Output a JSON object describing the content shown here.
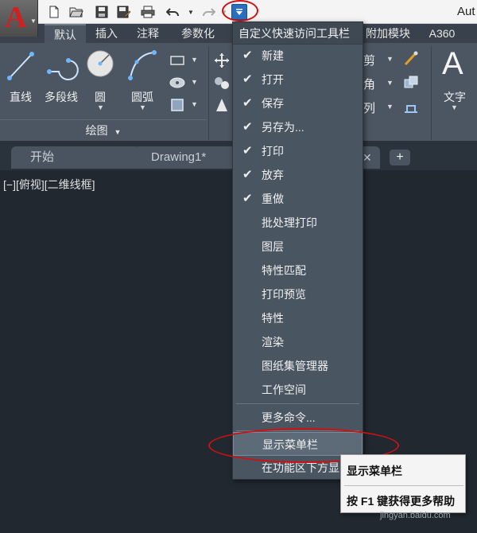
{
  "window": {
    "title_fragment": "Aut"
  },
  "quick_access": {
    "icons": [
      "new-icon",
      "open-icon",
      "save-icon",
      "save-as-icon",
      "print-icon",
      "undo-icon",
      "redo-icon",
      "customize-dropdown-icon"
    ]
  },
  "ribbon_tabs": [
    "默认",
    "插入",
    "注释",
    "参数化",
    "附加模块",
    "A360"
  ],
  "ribbon": {
    "tools": [
      "直线",
      "多段线",
      "圆",
      "圆弧"
    ],
    "panel_title": "绘图",
    "right_labels": [
      "剪",
      "角",
      "列"
    ],
    "text_tool": "文字"
  },
  "doc_tabs": [
    "开始",
    "Drawing1*"
  ],
  "viewport_label": "[−][俯视][二维线框]",
  "menu": {
    "title": "自定义快速访问工具栏",
    "items": [
      {
        "label": "新建",
        "checked": true
      },
      {
        "label": "打开",
        "checked": true
      },
      {
        "label": "保存",
        "checked": true
      },
      {
        "label": "另存为...",
        "checked": true
      },
      {
        "label": "打印",
        "checked": true
      },
      {
        "label": "放弃",
        "checked": true
      },
      {
        "label": "重做",
        "checked": true
      },
      {
        "label": "批处理打印",
        "checked": false
      },
      {
        "label": "图层",
        "checked": false
      },
      {
        "label": "特性匹配",
        "checked": false
      },
      {
        "label": "打印预览",
        "checked": false
      },
      {
        "label": "特性",
        "checked": false
      },
      {
        "label": "渲染",
        "checked": false
      },
      {
        "label": "图纸集管理器",
        "checked": false
      },
      {
        "label": "工作空间",
        "checked": false
      }
    ],
    "more_commands": "更多命令...",
    "show_menubar": "显示菜单栏",
    "below_ribbon": "在功能区下方显"
  },
  "tooltip": {
    "title": "显示菜单栏",
    "help": "按 F1 键获得更多帮助"
  },
  "watermark": "jingyan.baidu.com",
  "colors": {
    "accent_red": "#d01010",
    "app_logo_red": "#d21f1f",
    "menu_bg": "#4a5562",
    "canvas_bg": "#212830"
  }
}
